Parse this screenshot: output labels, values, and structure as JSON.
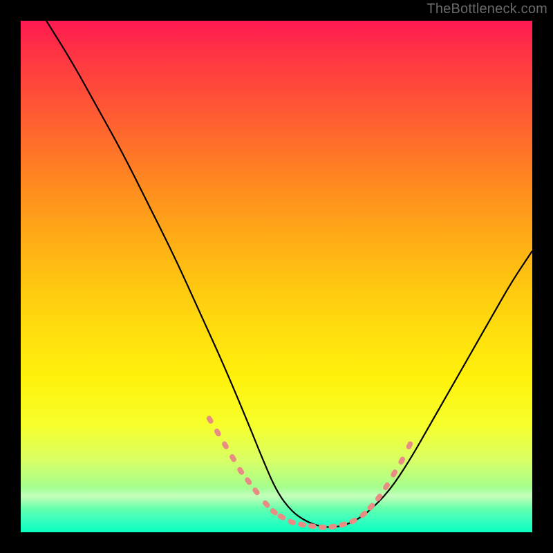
{
  "watermark": "TheBottleneck.com",
  "colors": {
    "background": "#000000",
    "curve_stroke": "#000000",
    "dot_fill": "#e98c84",
    "gradient_top": "#ff1a52",
    "gradient_bottom": "#08ffbd"
  },
  "chart_data": {
    "type": "line",
    "title": "",
    "xlabel": "",
    "ylabel": "",
    "xlim": [
      0,
      100
    ],
    "ylim": [
      0,
      100
    ],
    "series": [
      {
        "name": "curve",
        "x": [
          5,
          10,
          15,
          20,
          25,
          30,
          35,
          40,
          45,
          47,
          50,
          53,
          56,
          59,
          62,
          65,
          68,
          72,
          76,
          80,
          84,
          88,
          92,
          96,
          100
        ],
        "y": [
          100,
          92,
          83,
          74,
          64,
          54,
          43,
          32,
          20,
          15,
          8,
          4,
          2,
          1,
          1,
          2,
          4,
          8,
          14,
          21,
          28,
          35,
          42,
          49,
          55
        ]
      }
    ],
    "dots": {
      "name": "highlight-dots",
      "x": [
        37,
        38.5,
        40,
        41.5,
        43,
        44.5,
        46,
        48,
        49.5,
        51,
        53,
        55,
        57,
        59,
        61,
        63,
        65,
        67,
        68.5,
        70,
        71.5,
        73,
        74.5,
        76
      ],
      "y": [
        22,
        19.5,
        17,
        14.5,
        12,
        10,
        8,
        5.5,
        4,
        3,
        2,
        1.5,
        1.2,
        1,
        1.1,
        1.5,
        2.2,
        3.5,
        5,
        6.8,
        9,
        11.5,
        14,
        17
      ]
    }
  }
}
